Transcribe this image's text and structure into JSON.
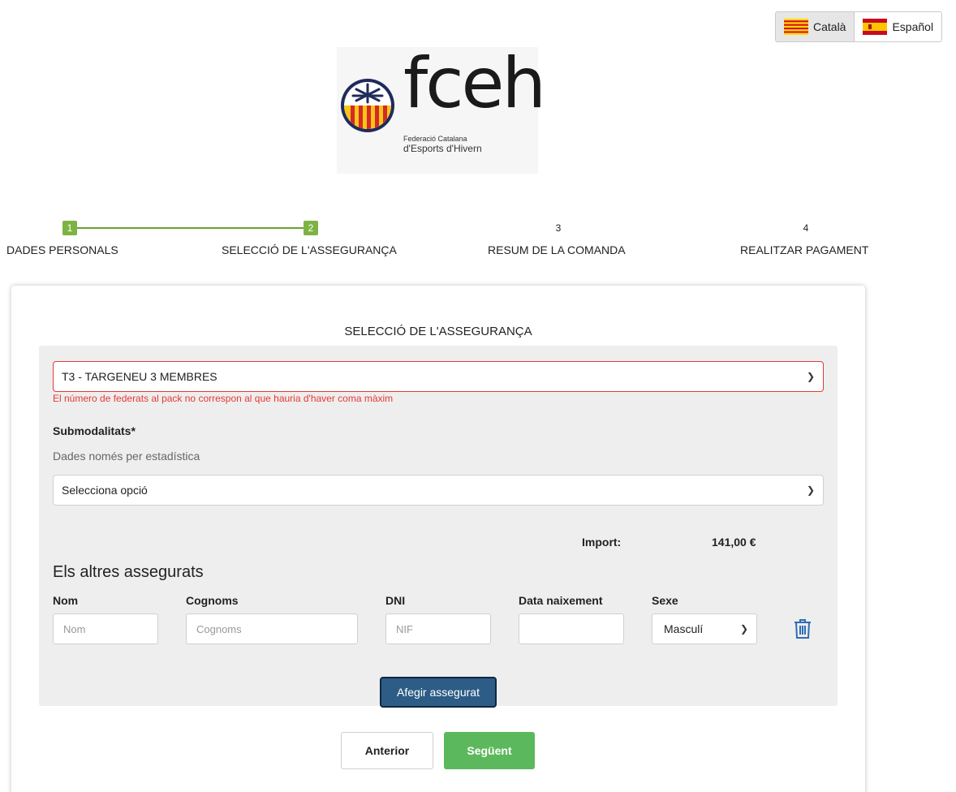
{
  "language": {
    "options": [
      {
        "label": "Català",
        "flag": "catalan-flag-icon",
        "active": true
      },
      {
        "label": "Español",
        "flag": "spanish-flag-icon",
        "active": false
      }
    ]
  },
  "logo": {
    "wordmark": "fceh",
    "subtitle_line1": "Federació Catalana",
    "subtitle_line2": "d'Esports d'Hivern"
  },
  "stepper": {
    "steps": [
      {
        "number": "1",
        "label": "DADES PERSONALS",
        "state": "done"
      },
      {
        "number": "2",
        "label": "SELECCIÓ DE L'ASSEGURANÇA",
        "state": "current"
      },
      {
        "number": "3",
        "label": "RESUM DE LA COMANDA",
        "state": "todo"
      },
      {
        "number": "4",
        "label": "REALITZAR PAGAMENT",
        "state": "todo"
      }
    ],
    "accent_color": "#7cb342"
  },
  "form": {
    "title": "SELECCIÓ DE L'ASSEGURANÇA",
    "insurance_select_value": "T3 - TARGENEU 3 MEMBRES",
    "error_message": "El número de federats al pack no correspon al que hauria d'haver coma màxim",
    "submodalities_label": "Submodalitats*",
    "submodalities_hint": "Dades només per estadística",
    "submodalities_select_value": "Selecciona opció",
    "import_label": "Import:",
    "import_value": "141,00 €",
    "others_title": "Els altres assegurats",
    "columns": {
      "nom": "Nom",
      "cognoms": "Cognoms",
      "dni": "DNI",
      "data": "Data naixement",
      "sexe": "Sexe"
    },
    "placeholders": {
      "nom": "Nom",
      "cognoms": "Cognoms",
      "dni": "NIF",
      "data": ""
    },
    "sex_value": "Masculí",
    "add_button": "Afegir assegurat",
    "error_color": "#e53935",
    "add_button_color": "#2d5d86"
  },
  "nav": {
    "prev": "Anterior",
    "next": "Següent",
    "next_color": "#5cb85c"
  }
}
